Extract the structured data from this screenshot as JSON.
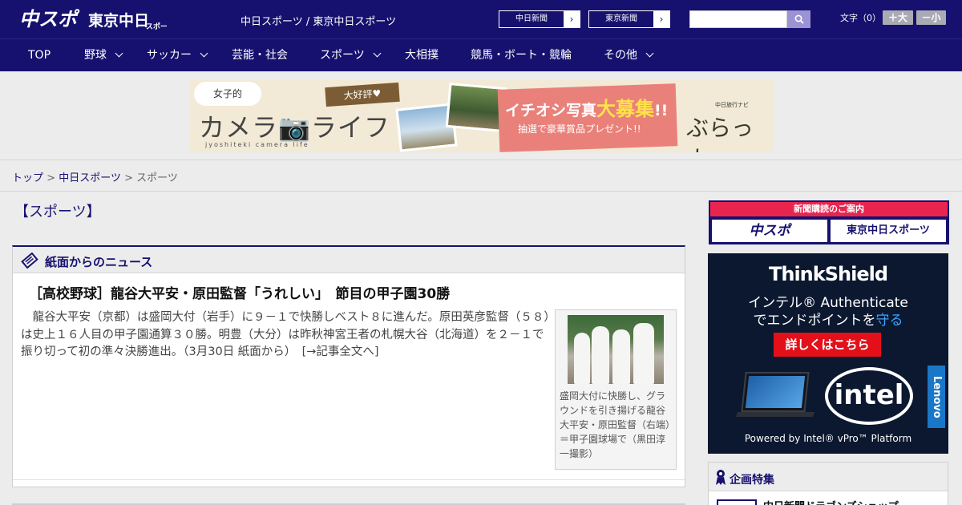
{
  "header": {
    "logo_text": "中スポ 東京中日スポーツ",
    "site_names": "中日スポーツ / 東京中日スポーツ",
    "paper_links": [
      {
        "label": "中日新聞",
        "chevron": "›"
      },
      {
        "label": "東京新聞",
        "chevron": "›"
      }
    ],
    "search": {
      "placeholder": "",
      "value": "",
      "icon": "search-icon"
    },
    "font_size": {
      "label": "文字（0）",
      "increase": "＋大",
      "decrease": "－小"
    }
  },
  "nav": {
    "items": [
      {
        "label": "TOP",
        "has_dropdown": false
      },
      {
        "label": "野球",
        "has_dropdown": true
      },
      {
        "label": "サッカー",
        "has_dropdown": true
      },
      {
        "label": "芸能・社会",
        "has_dropdown": false
      },
      {
        "label": "スポーツ",
        "has_dropdown": true
      },
      {
        "label": "大相撲",
        "has_dropdown": false
      },
      {
        "label": "競馬・ボート・競輪",
        "has_dropdown": false
      },
      {
        "label": "その他",
        "has_dropdown": true
      }
    ]
  },
  "banner": {
    "bubble": "女子的",
    "title": "カメラ📷ライフ",
    "subtitle": "jyoshiteki camera life",
    "tag": "大好評♥",
    "headline_pre": "イチオシ写真",
    "headline_big": "大募集",
    "headline_post": "!!",
    "subline": "抽選で豪華賞品プレゼント!!",
    "brand_small": "中日旅行ナビ",
    "brand": "ぶらっ人"
  },
  "breadcrumb": {
    "items": [
      "トップ",
      "中日スポーツ"
    ],
    "separator": ">",
    "current": "スポーツ"
  },
  "main": {
    "page_heading": "【スポーツ】",
    "section_title": "紙面からのニュース",
    "article": {
      "title": "［高校野球］龍谷大平安・原田監督「うれしい」　節目の甲子園30勝",
      "body": "龍谷大平安（京都）は盛岡大付（岩手）に９－１で快勝しベスト８に進んだ。原田英彦監督（５８）は史上１６人目の甲子園通算３０勝。明豊（大分）は昨秋神宮王者の札幌大谷（北海道）を２－１で振り切って初の準々決勝進出。（3月30日 紙面から）　",
      "read_more": "[→記事全文へ]",
      "photo_caption": "盛岡大付に快勝し、グラウンドを引き揚げる龍谷大平安・原田監督（右端）＝甲子園球場で（黒田淳一撮影）"
    }
  },
  "sidebar": {
    "subscribe": {
      "header": "新聞購読のご案内",
      "links": [
        "中スポ",
        "東京中日スポーツ"
      ]
    },
    "ad": {
      "brand": "ThinkShield",
      "line1": "インテル® Authenticate",
      "line2_pre": "でエンドポイントを",
      "line2_hl": "守る",
      "cta": "詳しくはこちら",
      "intel": "intel",
      "lenovo": "Lenovo",
      "powered": "Powered by Intel® vPro™ Platform"
    },
    "kikaku": {
      "title": "企画特集",
      "items": [
        "中日新聞ドラゴンズショップ"
      ]
    }
  },
  "colors": {
    "navy": "#16116e",
    "red": "#e8254f",
    "search_button": "#9c93d4"
  }
}
